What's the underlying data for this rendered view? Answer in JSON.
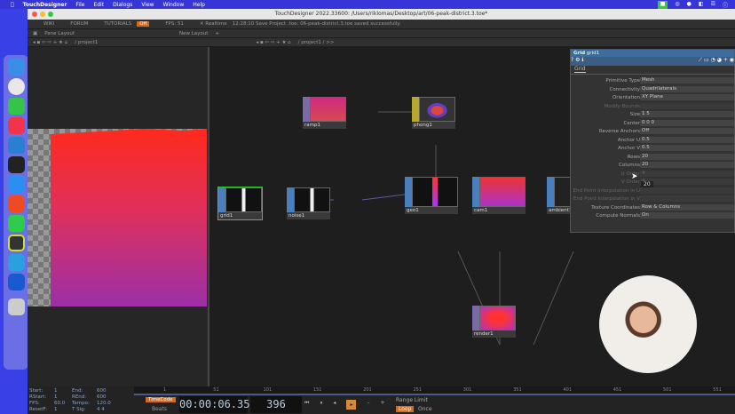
{
  "menubar": {
    "app": "TouchDesigner",
    "items": [
      "File",
      "Edit",
      "Dialogs",
      "View",
      "Window",
      "Help"
    ]
  },
  "window": {
    "title": "TouchDesigner 2022.33600: /Users/riklomas/Desktop/art/06-peak-district.3.toe*"
  },
  "toolbar1": {
    "wiki": "WIKI",
    "forum": "FORUM",
    "tutorials": "TUTORIALS",
    "off": "Off",
    "fps_label": "FPS:",
    "fps": "51",
    "realtime": "Realtime",
    "status": "12:28:10 Save Project .toe: 06-peak-district.3.toe saved successfully."
  },
  "toolbar2": {
    "pane_layout": "Pane Layout",
    "new_layout": "New Layout"
  },
  "paths": {
    "left": "/ project1",
    "right": "/ project1 / >>"
  },
  "nodes": [
    {
      "name": "ramp1",
      "color": "#7a6aa8"
    },
    {
      "name": "phong1",
      "color": "#b8a830"
    },
    {
      "name": "grid1",
      "color": "#4a7fbf"
    },
    {
      "name": "noise1",
      "color": "#4a7fbf"
    },
    {
      "name": "geo1",
      "color": "#4a7fbf"
    },
    {
      "name": "cam1",
      "color": "#4a7fbf"
    },
    {
      "name": "ambient1",
      "color": "#4a7fbf"
    },
    {
      "name": "render1",
      "color": "#7a6aa8"
    }
  ],
  "params": {
    "type": "Grid",
    "name": "grid1",
    "tab": "Grid",
    "rows": [
      {
        "label": "Primitive Type",
        "value": "Mesh"
      },
      {
        "label": "Connectivity",
        "value": "Quadrilaterals"
      },
      {
        "label": "Orientation",
        "value": "XY Plane"
      },
      {
        "label": "Modify Bounds",
        "value": ""
      },
      {
        "label": "Size",
        "value": "1          5"
      },
      {
        "label": "Center",
        "value": "0          0          0"
      },
      {
        "label": "Reverse Anchors",
        "value": "Off"
      },
      {
        "label": "Anchor U",
        "value": "0.5"
      },
      {
        "label": "Anchor V",
        "value": "0.5"
      },
      {
        "label": "Rows",
        "value": "20"
      },
      {
        "label": "Columns",
        "value": "20"
      },
      {
        "label": "U Order",
        "value": "4"
      },
      {
        "label": "V Order",
        "value": "4"
      },
      {
        "label": "End Point Interpolation in U",
        "value": ""
      },
      {
        "label": "End Point Interpolation in V",
        "value": ""
      },
      {
        "label": "Texture Coordinates",
        "value": "Row & Columns"
      },
      {
        "label": "Compute Normals",
        "value": "On"
      }
    ],
    "tooltip": "20"
  },
  "stats": {
    "start_l": "Start:",
    "start": "1",
    "end_l": "End:",
    "end": "600",
    "rstart_l": "RStart:",
    "rstart": "1",
    "rend_l": "REnd:",
    "rend": "600",
    "fps_l": "FPS:",
    "fps": "60.0",
    "tempo_l": "Tempo:",
    "tempo": "120.0",
    "resetf_l": "ResetF:",
    "resetf": "1",
    "tsig_l": "T Sig:",
    "tsig": "4    4"
  },
  "timeline": {
    "ticks": [
      "1",
      "51",
      "101",
      "151",
      "201",
      "251",
      "301",
      "351",
      "401",
      "451",
      "501",
      "551",
      "601"
    ]
  },
  "transport": {
    "timecode_btn": "TimeCode",
    "beats_btn": "Beats",
    "timecode": "00:00:06.35",
    "frame": "396",
    "range_limit": "Range Limit",
    "loop": "Loop",
    "once": "Once"
  }
}
